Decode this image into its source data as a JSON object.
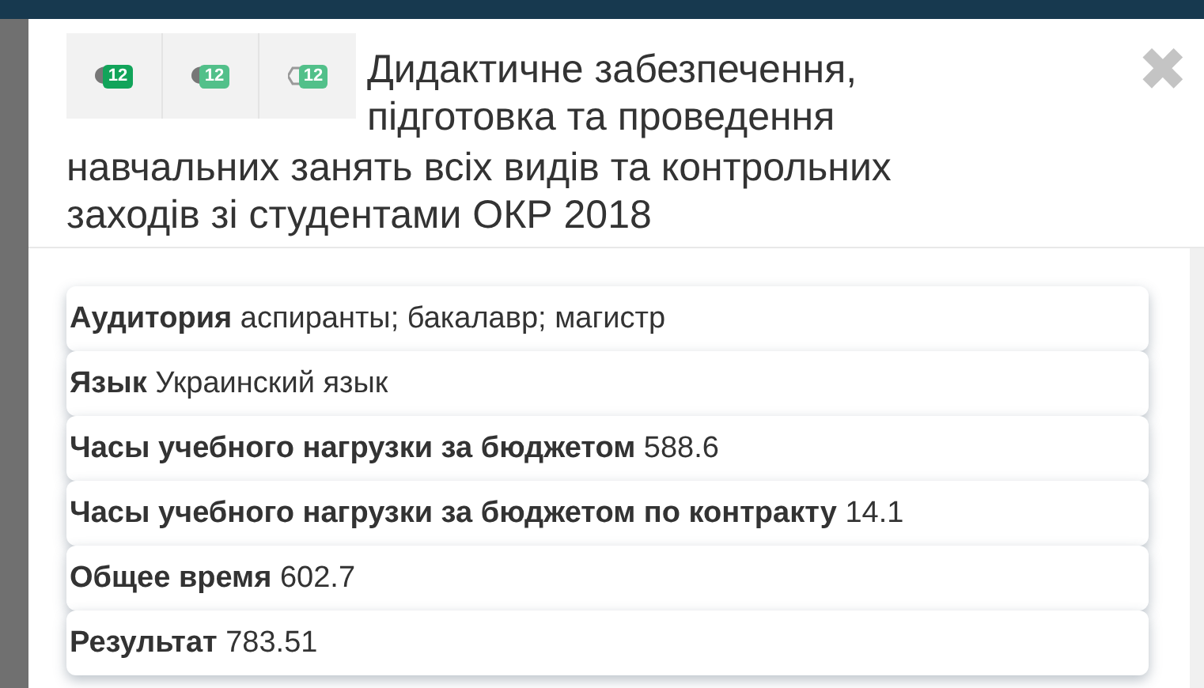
{
  "toolbar": [
    {
      "kind": "comment",
      "badge": "12"
    },
    {
      "kind": "comment-light",
      "badge": "12"
    },
    {
      "kind": "tag",
      "badge": "12"
    }
  ],
  "title": [
    "Дидактичне забезпечення, підготовка та проведення",
    "навчальних занять всіх видів та контрольних заходів зі студентами ОКР 2018"
  ],
  "close": "✖",
  "rows": [
    {
      "label": "Аудитория",
      "value": "аспиранты; бакалавр; магистр"
    },
    {
      "label": "Язык",
      "value": "Украинский язык"
    },
    {
      "label": "Часы учебного нагрузки за бюджетом",
      "value": "588.6"
    },
    {
      "label": "Часы учебного нагрузки за бюджетом по контракту",
      "value": "14.1"
    },
    {
      "label": "Общее время",
      "value": "602.7"
    },
    {
      "label": "Результат",
      "value": "783.51"
    }
  ]
}
